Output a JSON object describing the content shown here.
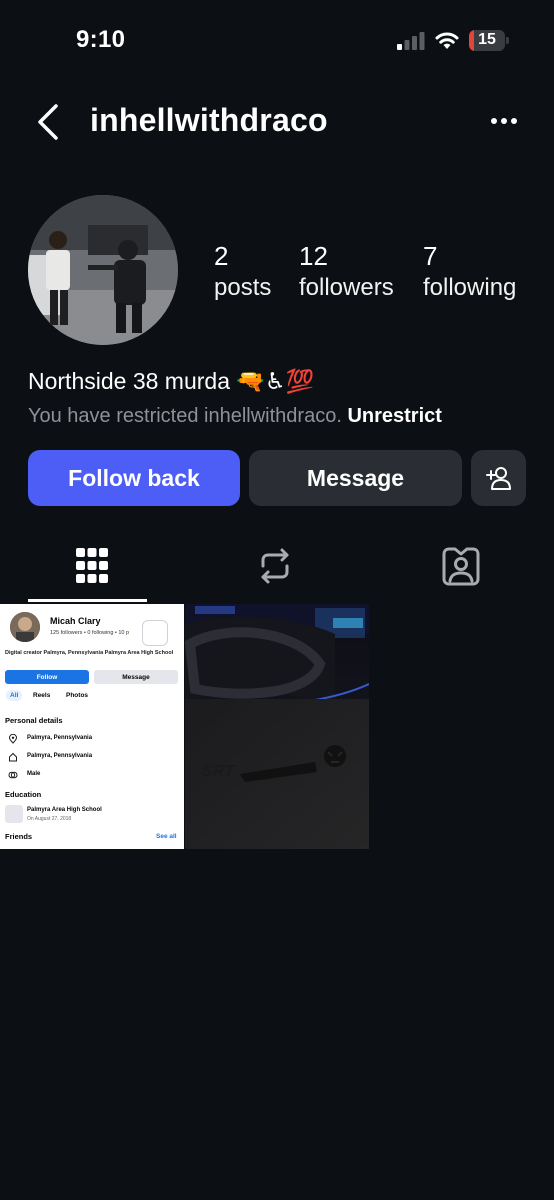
{
  "status_bar": {
    "time": "9:10",
    "battery": "15",
    "battery_color": "#e2453c"
  },
  "header": {
    "username": "inhellwithdraco",
    "back_icon": "chevron-left-icon",
    "more_icon": "more-horizontal-icon"
  },
  "profile": {
    "posts_count": "2",
    "posts_label": "posts",
    "followers_count": "12",
    "followers_label": "followers",
    "following_count": "7",
    "following_label": "following",
    "bio": "Northside 38 murda 🔫♿💯",
    "restricted_text": "You have restricted inhellwithdraco. ",
    "restricted_action": "Unrestrict"
  },
  "actions": {
    "follow_back": "Follow back",
    "message": "Message",
    "add_user_icon": "add-person-icon",
    "accent": "#4c5ef6"
  },
  "tabs": [
    {
      "icon": "grid-icon",
      "selected": true
    },
    {
      "icon": "repost-icon",
      "selected": false
    },
    {
      "icon": "tagged-icon",
      "selected": false
    }
  ],
  "posts": {
    "post1": {
      "name": "Micah Clary",
      "followers_line": "125 followers • 0 following • 10 p",
      "meta_line": "Digital creator  Palmyra, Pennsylvania  Palmyra Area High School",
      "follow": "Follow",
      "message": "Message",
      "tab_all": "All",
      "tab_reels": "Reels",
      "tab_photos": "Photos",
      "personal_details": "Personal details",
      "detail1": "Palmyra, Pennsylvania",
      "detail2": "Palmyra, Pennsylvania",
      "detail3": "Male",
      "education": "Education",
      "school": "Palmyra Area High School",
      "school_date": "On August 27, 2018",
      "friends": "Friends",
      "see_all": "See all"
    }
  }
}
